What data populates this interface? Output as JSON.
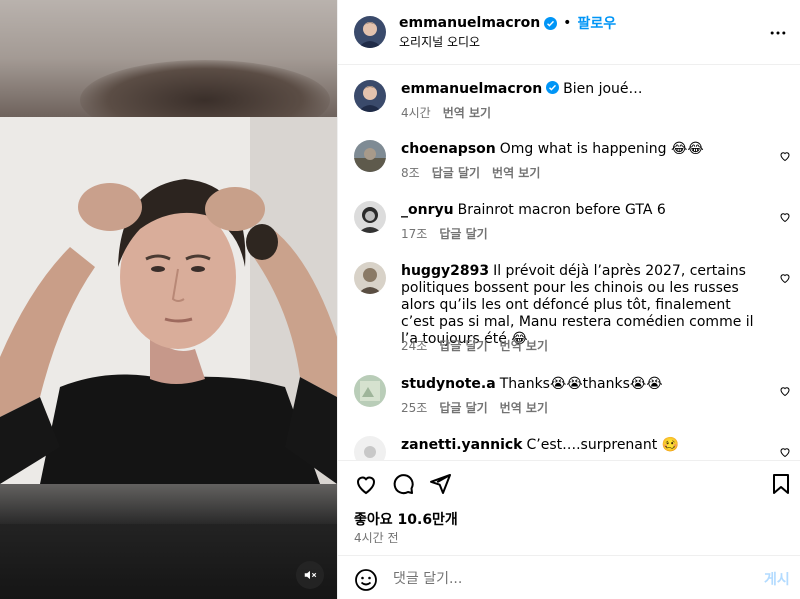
{
  "post": {
    "author": "emmanuelmacron",
    "follow_label": "팔로우",
    "audio_label": "오리지널 오디오",
    "separator": "•"
  },
  "caption": {
    "user": "emmanuelmacron",
    "text": "Bien joué…",
    "time": "4시간",
    "translate": "번역 보기"
  },
  "comments": [
    {
      "user": "choenapson",
      "text": "Omg what is happening 😂😂",
      "time": "8조",
      "reply": "답글 달기",
      "translate": "번역 보기"
    },
    {
      "user": "_onryu",
      "text": "Brainrot macron before GTA 6",
      "time": "17조",
      "reply": "답글 달기"
    },
    {
      "user": "huggy2893",
      "text": "Il prévoit déjà l’après 2027, certains politiques bossent pour les chinois ou les russes alors qu’ils les ont défoncé plus tôt, finalement c’est pas si mal, Manu restera comédien comme il l’a toujours été 😂",
      "time": "24조",
      "reply": "답글 달기",
      "translate": "번역 보기"
    },
    {
      "user": "studynote.a",
      "text": "Thanks😭😭thanks😭😭",
      "time": "25조",
      "reply": "답글 달기",
      "translate": "번역 보기"
    },
    {
      "user": "zanetti.yannick",
      "text": "C’est….surprenant 🥴"
    }
  ],
  "stats": {
    "likes": "좋아요 10.6만개",
    "time": "4시간 전"
  },
  "compose": {
    "placeholder": "댓글 달기...",
    "post_label": "게시"
  },
  "icons": {
    "more": "more-icon",
    "like": "heart-icon",
    "comment": "comment-icon",
    "share": "share-icon",
    "save": "bookmark-icon",
    "mute": "muted-speaker-icon",
    "emoji": "emoji-icon",
    "verified": "verified-badge-icon"
  },
  "colors": {
    "accent": "#0095f6",
    "muted_text": "#737373",
    "post_button_disabled": "#b3dbff",
    "divider": "#efefef"
  }
}
